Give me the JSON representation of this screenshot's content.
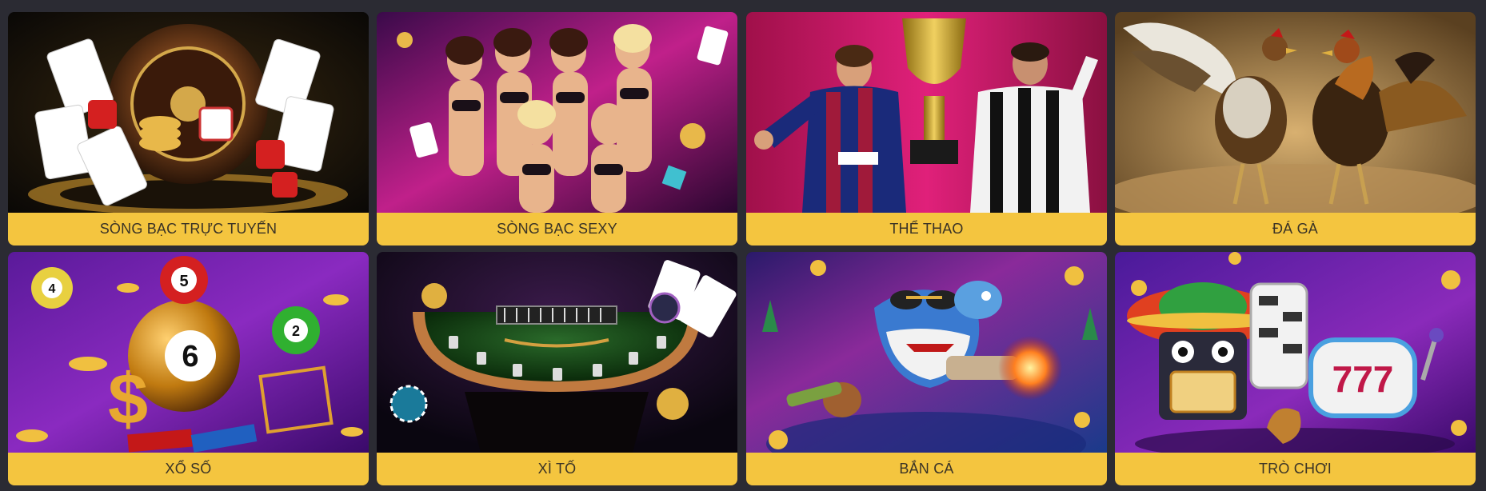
{
  "categories": [
    {
      "label": "SÒNG BẠC TRỰC TUYẾN",
      "icon": "roulette-cards-image"
    },
    {
      "label": "SÒNG BẠC SEXY",
      "icon": "live-dealers-image"
    },
    {
      "label": "THỂ THAO",
      "icon": "football-trophy-image"
    },
    {
      "label": "ĐÁ GÀ",
      "icon": "cockfight-image"
    },
    {
      "label": "XỔ SỐ",
      "icon": "lottery-balls-image"
    },
    {
      "label": "XÌ TỐ",
      "icon": "poker-table-image"
    },
    {
      "label": "BẮN CÁ",
      "icon": "fish-shooter-image"
    },
    {
      "label": "TRÒ CHƠI",
      "icon": "slot-machine-image"
    }
  ],
  "colors": {
    "background": "#2b2b33",
    "label_bg": "#f4c53f",
    "label_text": "#3a3326"
  }
}
